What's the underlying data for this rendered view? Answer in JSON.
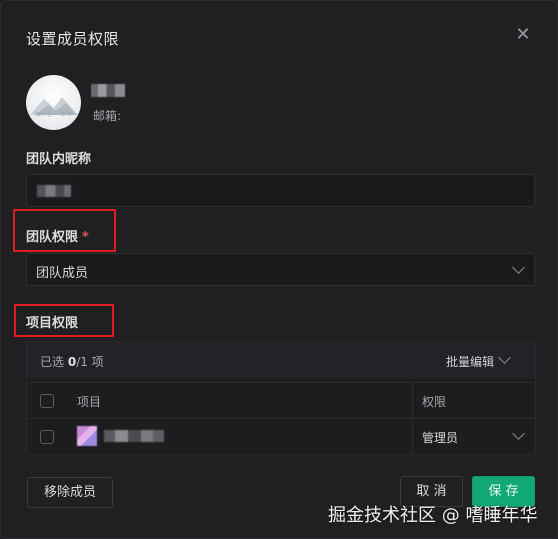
{
  "dialog": {
    "title": "设置成员权限",
    "close_icon": "close-icon"
  },
  "member": {
    "avatar_caption": "知行 合 一 读 书",
    "email_label": "邮箱:"
  },
  "nickname": {
    "label": "团队内昵称"
  },
  "team_permission": {
    "label": "团队权限",
    "required_mark": "*",
    "selected": "团队成员"
  },
  "project_permission": {
    "label": "项目权限",
    "selected_prefix": "已选 ",
    "selected_count": "0",
    "selected_suffix": "/1 项",
    "batch_edit": "批量编辑",
    "columns": {
      "project": "项目",
      "permission": "权限"
    },
    "rows": [
      {
        "permission": "管理员"
      }
    ]
  },
  "footer": {
    "remove_label": "移除成员",
    "cancel_label": "取 消",
    "save_label": "保 存"
  },
  "watermark": "掘金技术社区 @ 嗜睡年华",
  "colors": {
    "accent": "#12a873",
    "highlight_box": "#e11b22",
    "required": "#e05656"
  }
}
